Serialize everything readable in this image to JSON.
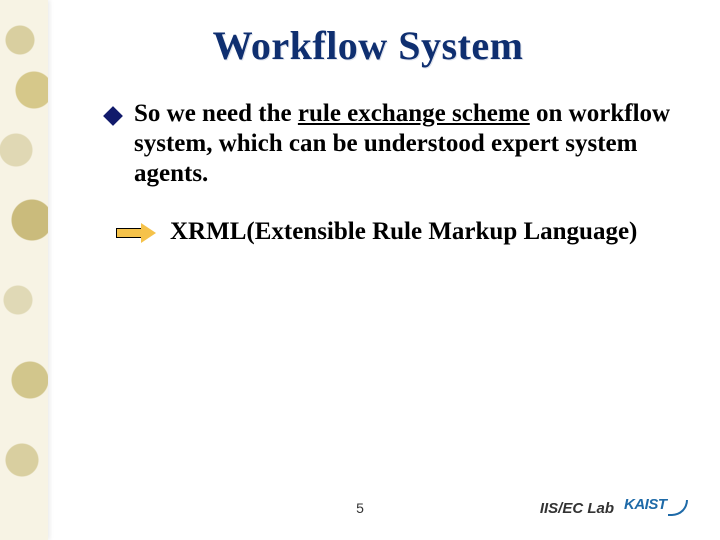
{
  "title": "Workflow System",
  "body": {
    "bullet1_pre": "So we need the ",
    "bullet1_underlined": "rule exchange scheme",
    "bullet1_post": " on workflow system, which can be understood expert system agents.",
    "arrow_text": "XRML(Extensible Rule Markup Language)"
  },
  "footer": {
    "page_number": "5",
    "lab_label": "IIS/EC Lab",
    "logo_text": "KAIST"
  }
}
